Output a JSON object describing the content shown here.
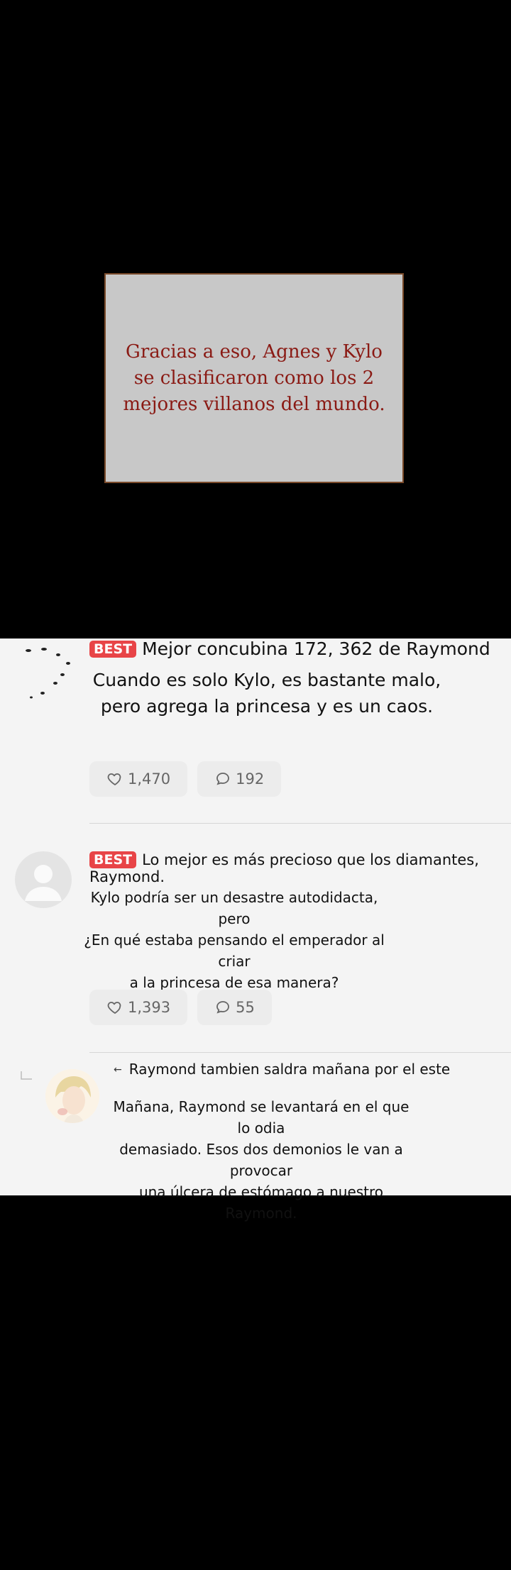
{
  "narration": {
    "text": "Gracias a eso, Agnes y Kylo\nse clasificaron como los 2\nmejores villanos del mundo."
  },
  "comments": [
    {
      "badge": "BEST",
      "title": "Mejor concubina 172, 362 de Raymond",
      "body": "Cuando es solo Kylo, es bastante malo,\npero agrega la princesa y es un caos.",
      "likes": "1,470",
      "replies": "192"
    },
    {
      "badge": "BEST",
      "title": "Lo mejor es más precioso que los diamantes, Raymond.",
      "body": "Kylo podría ser un desastre autodidacta, pero\n¿En qué estaba pensando el emperador al criar\na la princesa de esa manera?",
      "likes": "1,393",
      "replies": "55"
    },
    {
      "title": "Raymond tambien saldra mañana por el este",
      "body": "Mañana, Raymond se levantará en el que lo odia\ndemasiado. Esos dos demonios le van a provocar\nuna úlcera de estómago a nuestro Raymond."
    }
  ]
}
